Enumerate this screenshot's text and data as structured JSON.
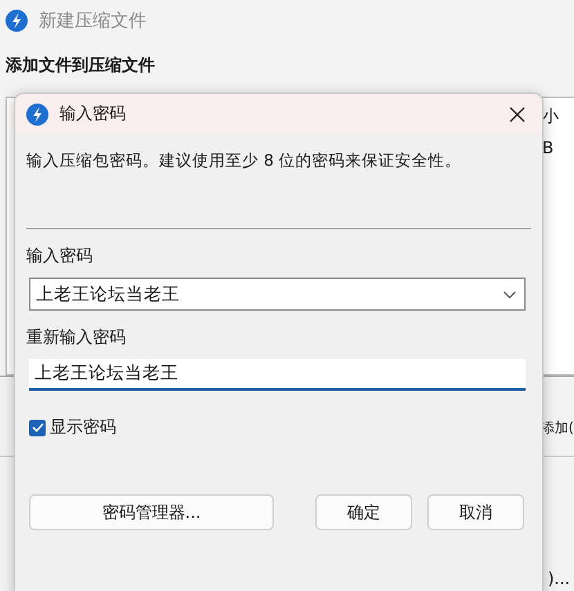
{
  "background_window": {
    "title": "新建压缩文件",
    "heading": "添加文件到压缩文件",
    "list_header_fragments": [
      "小"
    ],
    "list_row_fragments": [
      "B"
    ],
    "add_button_fragment": "添加(",
    "bottom_button_fragment": ")..."
  },
  "dialog": {
    "title": "输入密码",
    "message": "输入压缩包密码。建议使用至少 8 位的密码来保证安全性。",
    "password_label": "输入密码",
    "password": "上老王论坛当老王",
    "repeat_label": "重新输入密码",
    "repeat_password": "上老王论坛当老王",
    "show_password": {
      "label": "显示密码",
      "checked": true
    },
    "buttons": [
      {
        "label": "密码管理器...",
        "kind": "wide"
      },
      {
        "label": "确定",
        "kind": "normal"
      },
      {
        "label": "取消",
        "kind": "normal"
      }
    ]
  }
}
